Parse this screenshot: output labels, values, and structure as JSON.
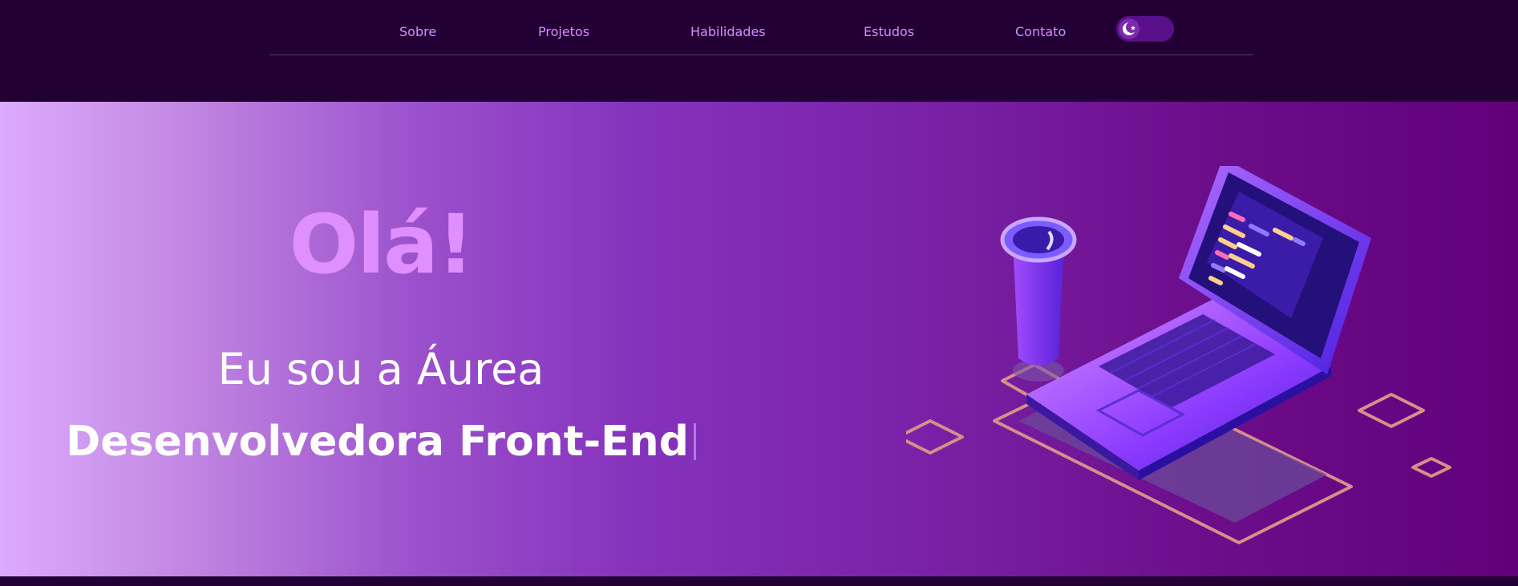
{
  "nav": {
    "items": [
      {
        "label": "Sobre"
      },
      {
        "label": "Projetos"
      },
      {
        "label": "Habilidades"
      },
      {
        "label": "Estudos"
      },
      {
        "label": "Contato"
      }
    ],
    "theme_toggle": {
      "icon": "moon-star-icon",
      "state": "dark"
    }
  },
  "hero": {
    "greeting": "Olá!",
    "intro": "Eu sou a Áurea",
    "role": "Desenvolvedora Front-End",
    "illustration": "laptop-coffee-isometric-illustration"
  },
  "colors": {
    "background": "#220033",
    "nav_link": "#d78cff",
    "greeting": "#e08fff",
    "hero_gradient_start": "#dcaaff",
    "hero_gradient_end": "#62007a"
  }
}
